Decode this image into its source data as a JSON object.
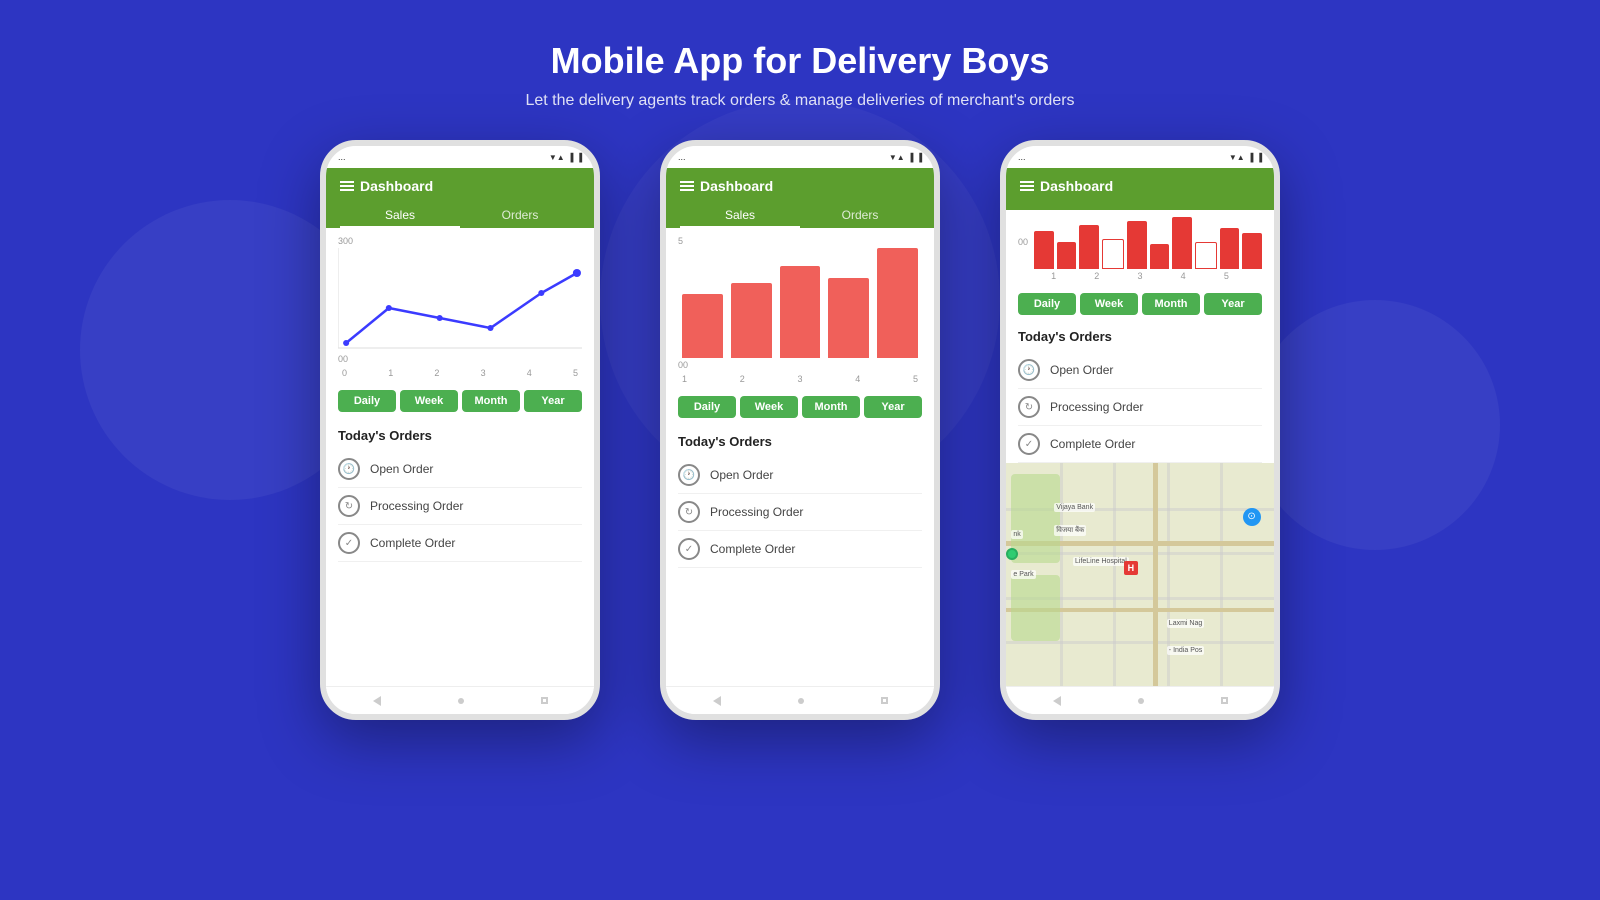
{
  "page": {
    "title": "Mobile App for Delivery Boys",
    "subtitle": "Let the delivery agents track orders & manage deliveries of merchant's orders",
    "bg_color": "#2d35c2"
  },
  "phones": [
    {
      "id": "phone1",
      "header": {
        "title": "Dashboard",
        "tabs": [
          "Sales",
          "Orders"
        ],
        "active_tab": "Sales"
      },
      "chart_type": "line",
      "chart": {
        "y_label": "300",
        "y_bottom": "00",
        "x_labels": [
          "0",
          "1",
          "2",
          "3",
          "4",
          "5"
        ]
      },
      "period_buttons": [
        "Daily",
        "Week",
        "Month",
        "Year"
      ],
      "orders_title": "Today's Orders",
      "orders": [
        {
          "icon": "clock",
          "label": "Open Order"
        },
        {
          "icon": "refresh",
          "label": "Processing Order"
        },
        {
          "icon": "check",
          "label": "Complete Order"
        }
      ]
    },
    {
      "id": "phone2",
      "header": {
        "title": "Dashboard",
        "tabs": [
          "Sales",
          "Orders"
        ],
        "active_tab": "Sales"
      },
      "chart_type": "bar",
      "chart": {
        "y_label": "5",
        "y_bottom": "00",
        "x_labels": [
          "1",
          "2",
          "3",
          "4",
          "5"
        ],
        "bars": [
          55,
          65,
          80,
          70,
          95
        ]
      },
      "period_buttons": [
        "Daily",
        "Week",
        "Month",
        "Year"
      ],
      "orders_title": "Today's Orders",
      "orders": [
        {
          "icon": "clock",
          "label": "Open Order"
        },
        {
          "icon": "refresh",
          "label": "Processing Order"
        },
        {
          "icon": "check",
          "label": "Complete Order"
        }
      ]
    },
    {
      "id": "phone3",
      "header": {
        "title": "Dashboard",
        "tabs": [],
        "active_tab": ""
      },
      "chart_type": "top_bar",
      "chart": {
        "y_label": "00",
        "x_labels": [
          "1",
          "2",
          "3",
          "4",
          "5"
        ],
        "bars": [
          70,
          50,
          80,
          60,
          85,
          45,
          90,
          55,
          75,
          65
        ]
      },
      "period_buttons": [
        "Daily",
        "Week",
        "Month",
        "Year"
      ],
      "orders_title": "Today's Orders",
      "orders": [
        {
          "icon": "clock",
          "label": "Open Order"
        },
        {
          "icon": "refresh",
          "label": "Processing Order"
        },
        {
          "icon": "check",
          "label": "Complete Order"
        }
      ],
      "map": {
        "labels": [
          "Vijaya Bank",
          "विजया बैंक",
          "LifeLine Hospital",
          "Laxmi Nag",
          "India Pos"
        ]
      }
    }
  ],
  "status_bar": {
    "time": "...",
    "signal": "▼▲▐",
    "battery": "▐"
  }
}
